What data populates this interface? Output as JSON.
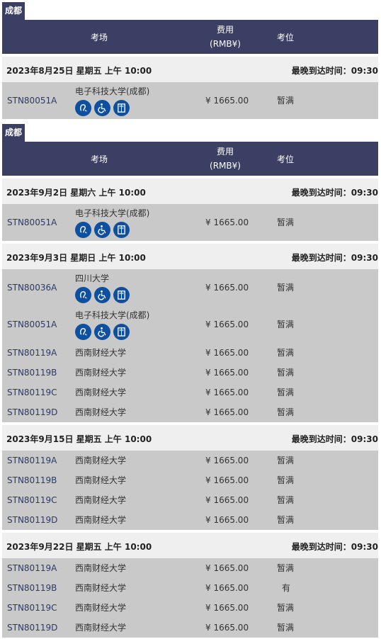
{
  "headers": {
    "venue": "考场",
    "fee_line1": "费用",
    "fee_line2": "(RMB¥)",
    "seat": "考位"
  },
  "sections": [
    {
      "city": "成都",
      "dates": [
        {
          "date": "2023年8月25日 星期五 上午 10:00",
          "arrive": "最晚到达时间：09:30",
          "rows": [
            {
              "code": "STN80051A",
              "venue": "电子科技大学(成都)",
              "fee": "¥ 1665.00",
              "seat": "暂满",
              "icons": [
                "hearing-assist-icon",
                "wheelchair-icon",
                "elevator-icon"
              ]
            }
          ]
        }
      ]
    },
    {
      "city": "成都",
      "dates": [
        {
          "date": "2023年9月2日 星期六 上午 10:00",
          "arrive": "最晚到达时间：09:30",
          "rows": [
            {
              "code": "STN80051A",
              "venue": "电子科技大学(成都)",
              "fee": "¥ 1665.00",
              "seat": "暂满",
              "icons": [
                "hearing-assist-icon",
                "wheelchair-icon",
                "elevator-icon"
              ]
            }
          ]
        },
        {
          "date": "2023年9月3日 星期日 上午 10:00",
          "arrive": "最晚到达时间：09:30",
          "rows": [
            {
              "code": "STN80036A",
              "venue": "四川大学",
              "fee": "¥ 1665.00",
              "seat": "暂满",
              "icons": [
                "hearing-assist-icon",
                "wheelchair-icon",
                "elevator-icon"
              ]
            },
            {
              "code": "STN80051A",
              "venue": "电子科技大学(成都)",
              "fee": "¥ 1665.00",
              "seat": "暂满",
              "icons": [
                "hearing-assist-icon",
                "wheelchair-icon",
                "elevator-icon"
              ]
            },
            {
              "code": "STN80119A",
              "venue": "西南财经大学",
              "fee": "¥ 1665.00",
              "seat": "暂满"
            },
            {
              "code": "STN80119B",
              "venue": "西南财经大学",
              "fee": "¥ 1665.00",
              "seat": "暂满"
            },
            {
              "code": "STN80119C",
              "venue": "西南财经大学",
              "fee": "¥ 1665.00",
              "seat": "暂满"
            },
            {
              "code": "STN80119D",
              "venue": "西南财经大学",
              "fee": "¥ 1665.00",
              "seat": "暂满"
            }
          ]
        },
        {
          "date": "2023年9月15日 星期五 上午 10:00",
          "arrive": "最晚到达时间：09:30",
          "rows": [
            {
              "code": "STN80119A",
              "venue": "西南财经大学",
              "fee": "¥ 1665.00",
              "seat": "暂满"
            },
            {
              "code": "STN80119B",
              "venue": "西南财经大学",
              "fee": "¥ 1665.00",
              "seat": "暂满"
            },
            {
              "code": "STN80119C",
              "venue": "西南财经大学",
              "fee": "¥ 1665.00",
              "seat": "暂满"
            },
            {
              "code": "STN80119D",
              "venue": "西南财经大学",
              "fee": "¥ 1665.00",
              "seat": "暂满"
            }
          ]
        },
        {
          "date": "2023年9月22日 星期五 上午 10:00",
          "arrive": "最晚到达时间：09:30",
          "rows": [
            {
              "code": "STN80119A",
              "venue": "西南财经大学",
              "fee": "¥ 1665.00",
              "seat": "暂满"
            },
            {
              "code": "STN80119B",
              "venue": "西南财经大学",
              "fee": "¥ 1665.00",
              "seat": "有"
            },
            {
              "code": "STN80119C",
              "venue": "西南财经大学",
              "fee": "¥ 1665.00",
              "seat": "暂满"
            },
            {
              "code": "STN80119D",
              "venue": "西南财经大学",
              "fee": "¥ 1665.00",
              "seat": "暂满"
            }
          ]
        }
      ]
    }
  ]
}
